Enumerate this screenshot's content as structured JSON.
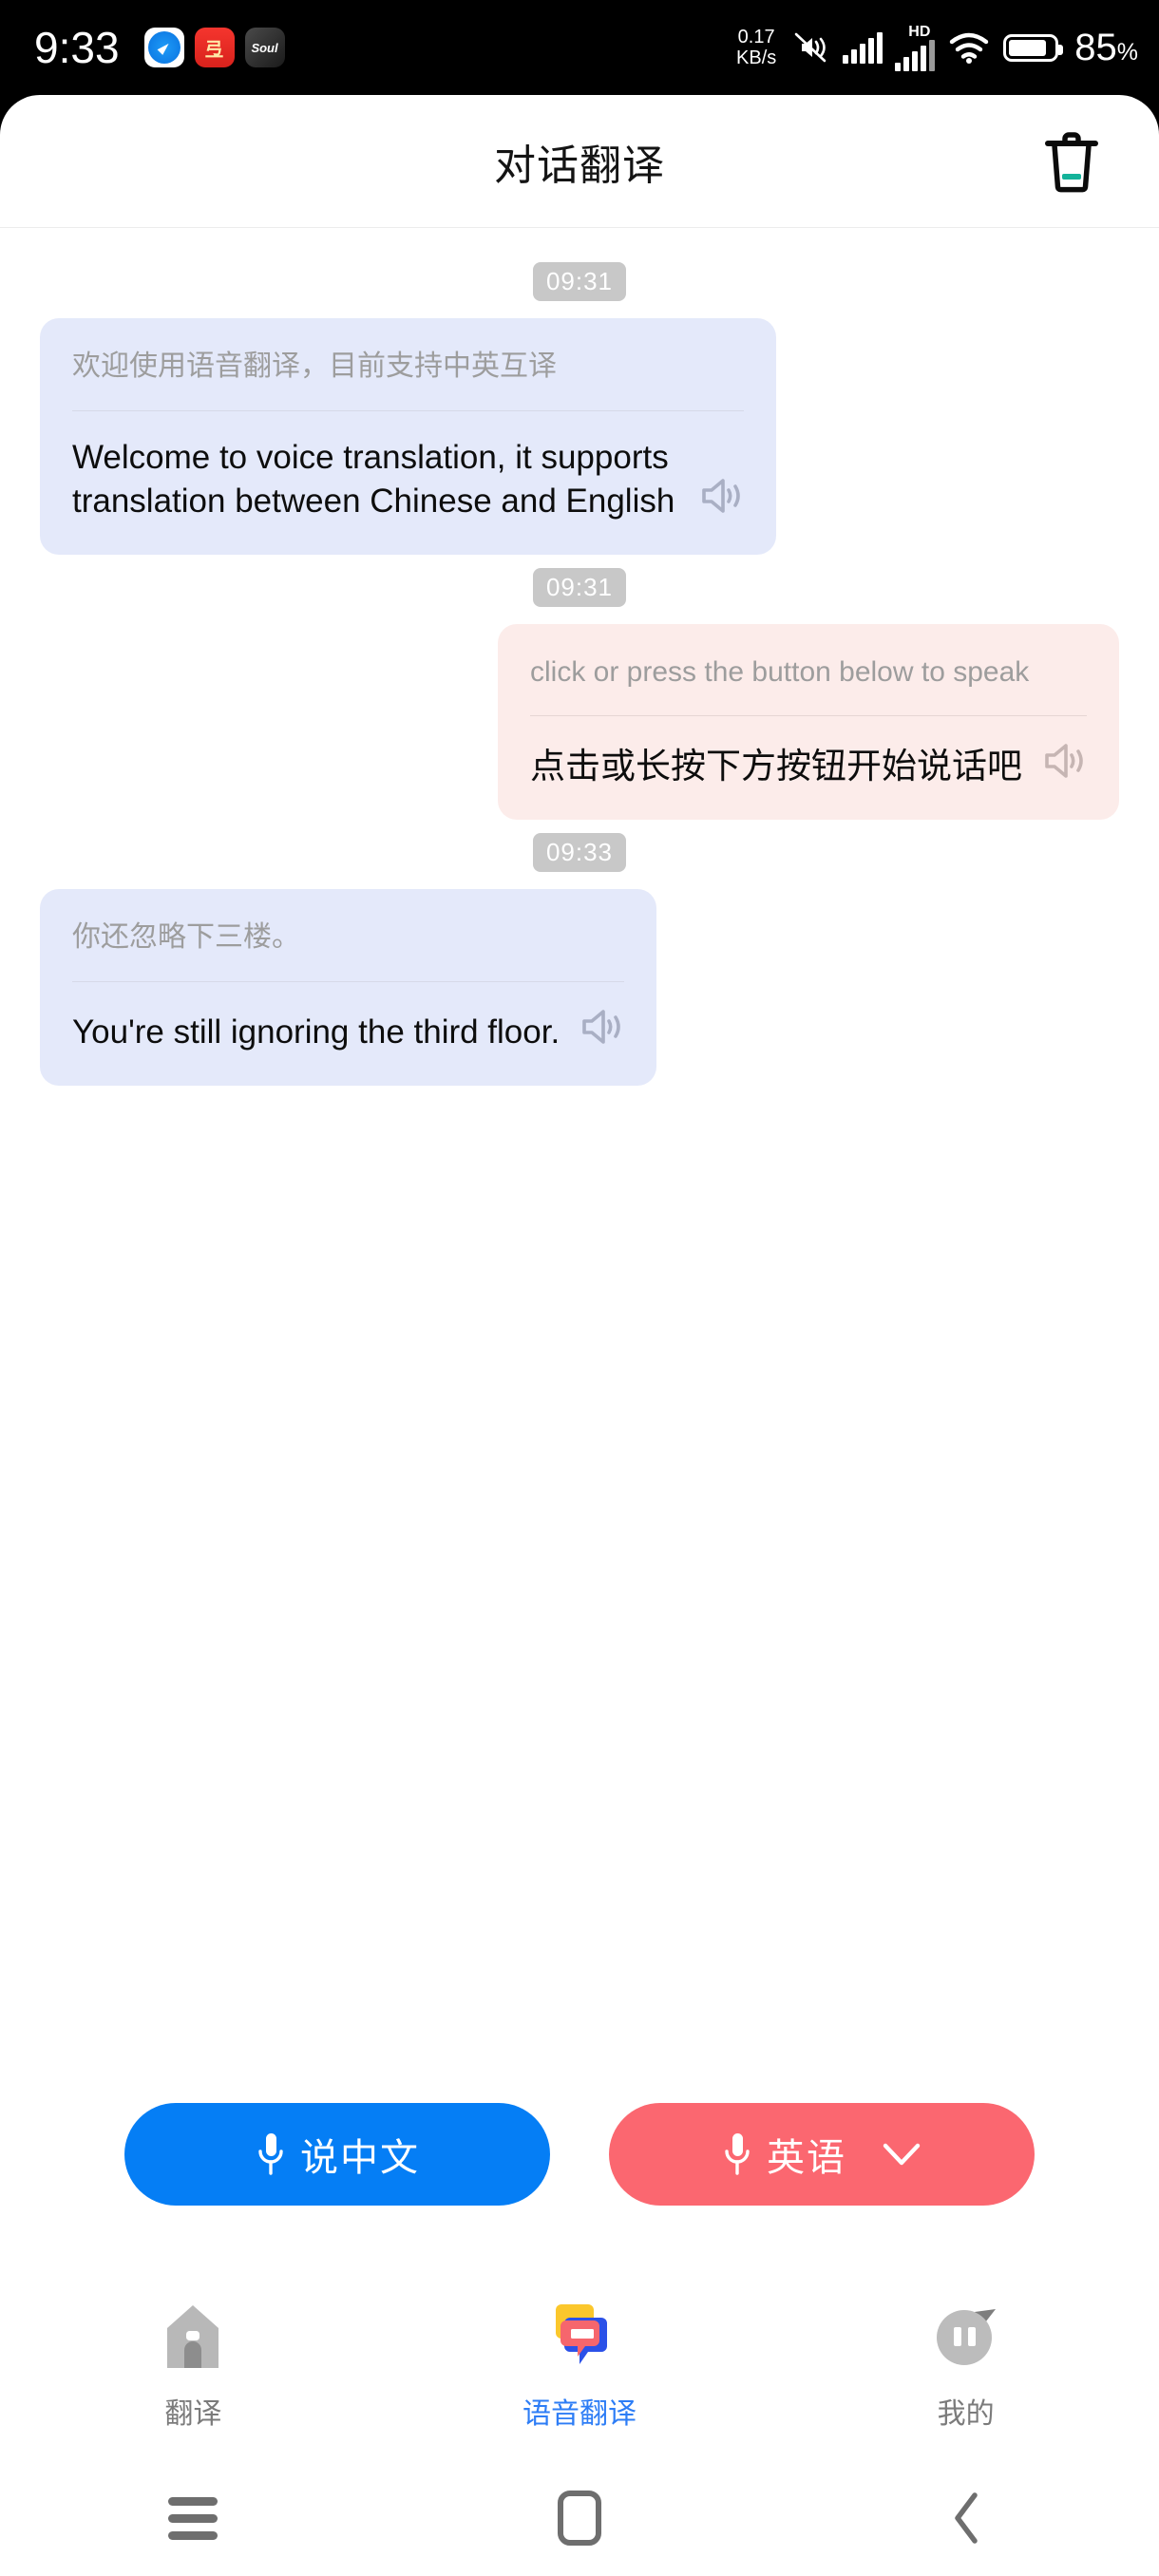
{
  "status_bar": {
    "time": "9:33",
    "network_speed_value": "0.17",
    "network_speed_unit": "KB/s",
    "hd_label": "HD",
    "battery_percent": "85",
    "percent_symbol": "%",
    "battery_level": 85,
    "apps": [
      {
        "name": "safari-app-icon",
        "label": ""
      },
      {
        "name": "red-app-icon",
        "label": "弖"
      },
      {
        "name": "soul-app-icon",
        "label": "Soul"
      }
    ],
    "icons": [
      "mute-icon",
      "signal-bars-icon",
      "hd-signal-icon",
      "wifi-icon",
      "battery-icon"
    ]
  },
  "header": {
    "title": "对话翻译",
    "delete_icon": "trash-icon",
    "accent_color": "#14b39a"
  },
  "chat": {
    "messages": [
      {
        "time": "09:31",
        "align": "left",
        "color": "#e4e9fa",
        "source": "欢迎使用语音翻译，目前支持中英互译",
        "target": "Welcome to voice translation, it supports translation between Chinese and English",
        "speaker_icon": "speaker-icon"
      },
      {
        "time": "09:31",
        "align": "right",
        "color": "#fcecea",
        "source": "click or press the button below to speak",
        "target": "点击或长按下方按钮开始说话吧",
        "speaker_icon": "speaker-icon"
      },
      {
        "time": "09:33",
        "align": "left",
        "color": "#e4e9fa",
        "source": "你还忽略下三楼。",
        "target": "You're still ignoring the third floor.",
        "speaker_icon": "speaker-icon"
      }
    ]
  },
  "actions": {
    "chinese_button": {
      "label": "说中文",
      "color": "#057ef5",
      "icon": "microphone-icon"
    },
    "english_button": {
      "label": "英语",
      "color": "#fb6770",
      "icon": "microphone-icon",
      "dropdown_icon": "chevron-down-icon"
    }
  },
  "tabbar": {
    "items": [
      {
        "label": "翻译",
        "icon": "home-icon",
        "active": false
      },
      {
        "label": "语音翻译",
        "icon": "speech-bubbles-icon",
        "active": true
      },
      {
        "label": "我的",
        "icon": "profile-icon",
        "active": false
      }
    ],
    "active_color": "#2d7df6",
    "inactive_color": "#7b7b7b"
  },
  "android_nav": {
    "recents_icon": "menu-icon",
    "home_icon": "home-square-icon",
    "back_icon": "back-chevron-icon"
  }
}
